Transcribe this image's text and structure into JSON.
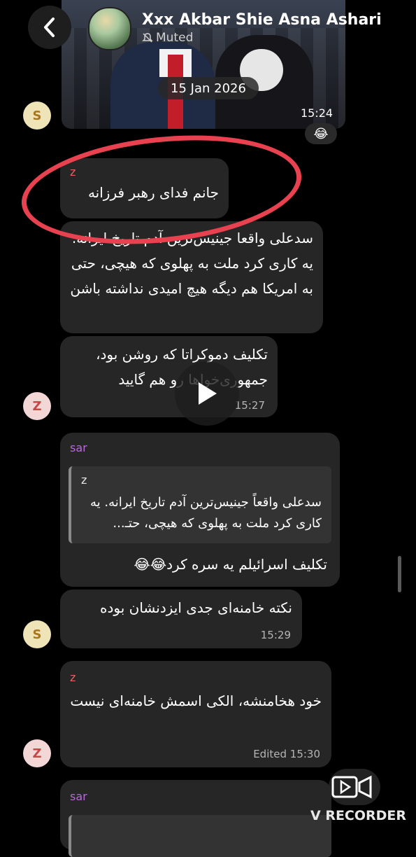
{
  "header": {
    "title": "Xxx Akbar Shie Asna Ashari...",
    "status": "Muted"
  },
  "media": {
    "date": "15 Jan 2026",
    "time": "15:24",
    "reaction": "😂"
  },
  "messages": [
    {
      "sender": "z",
      "text": "جانم فدای رهبر فرزانه"
    },
    {
      "text": "سدعلی واقعا جینیس‌ترین آدم تاریخ ایرانه. یه کاری کرد ملت به پهلوی که هیچی، حتی به امریکا هم دیگه هیچ امیدی نداشته باشن"
    },
    {
      "text": "تکلیف دموکراتا که روشن بود، جمهوری‌خواها رو هم گایید",
      "time": "15:27"
    },
    {
      "sender": "sar",
      "quote_sender": "z",
      "quote_text": "سدعلی واقعاً جینیس‌ترین آدم تاریخ ایرانه. یه کاری کرد ملت به پهلوی که هیچی، حتـ...",
      "text": "تکلیف اسرائیلم یه سره کرد😂😂"
    },
    {
      "text": "نکته خامنه‌ای جدی ایزدنشان بوده",
      "time": "15:29"
    },
    {
      "sender": "z",
      "text": "خود هخامنشه، الکی اسمش خامنه‌ای نیست",
      "time": "Edited 15:30"
    },
    {
      "sender": "sar"
    }
  ],
  "avatars": {
    "s": "S",
    "z": "Z"
  },
  "overlay": {
    "recorder_label": "V RECORDER"
  },
  "colors": {
    "bubble": "#262626",
    "annotation": "#e8414f",
    "sender_z": "#d96a5a",
    "sender_sar": "#b86ad9"
  }
}
